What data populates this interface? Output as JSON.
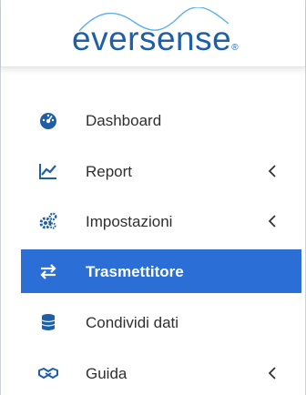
{
  "logo": {
    "text": "eversense",
    "mark": "®"
  },
  "menu": {
    "items": [
      {
        "label": "Dashboard",
        "icon": "dashboard-gauge-icon"
      },
      {
        "label": "Report",
        "icon": "line-chart-icon",
        "expandable": true
      },
      {
        "label": "Impostazioni",
        "icon": "cogs-icon",
        "expandable": true
      },
      {
        "label": "Trasmettitore",
        "icon": "exchange-arrows-icon",
        "active": true
      },
      {
        "label": "Condividi dati",
        "icon": "database-icon"
      },
      {
        "label": "Guida",
        "icon": "handshake-icon",
        "expandable": true
      }
    ]
  },
  "colors": {
    "accent": "#2b6fd6",
    "icon": "#1f5fa8",
    "brand": "#1f5fa8"
  }
}
